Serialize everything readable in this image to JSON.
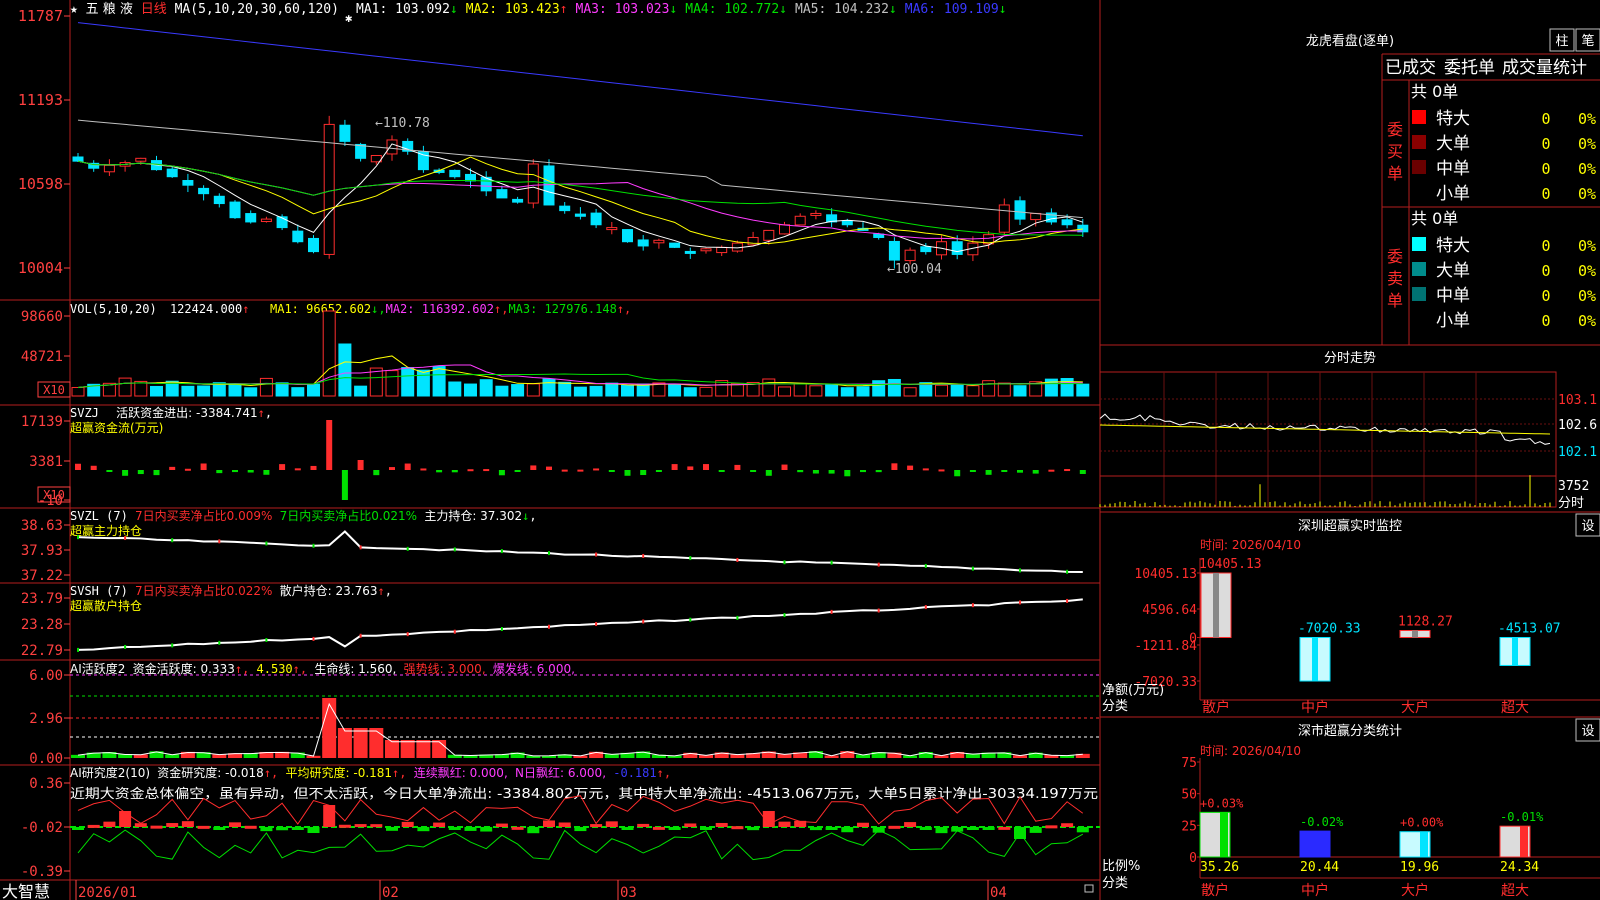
{
  "colors": {
    "bg": "#000000",
    "frame": "#b41e1e",
    "up": "#ff2d2d",
    "down": "#00e4ff",
    "green": "#00e000",
    "yellow": "#ffff00",
    "magenta": "#ff3cff",
    "white": "#ffffff",
    "blue": "#3a3aff",
    "gray": "#c0c0c0",
    "axis": "#ff4040"
  },
  "kline": {
    "header_star": "★",
    "title_name": "五 粮 液",
    "period": "日线",
    "ma_label": "MA(5,10,20,30,60,120)",
    "items": [
      {
        "text": "MA1: 103.092",
        "arrow": "↓",
        "color": "#ffffff"
      },
      {
        "text": "MA2: 103.423",
        "arrow": "↑",
        "color": "#ffff00"
      },
      {
        "text": "MA3: 103.023",
        "arrow": "↓",
        "color": "#ff3cff"
      },
      {
        "text": "MA4: 102.772",
        "arrow": "↓",
        "color": "#00e000"
      },
      {
        "text": "MA5: 104.232",
        "arrow": "↓",
        "color": "#c0c0c0"
      },
      {
        "text": "MA6: 109.109",
        "arrow": "↓",
        "color": "#3a3aff"
      }
    ],
    "yaxis": [
      "11787",
      "11193",
      "10598",
      "10004"
    ],
    "high_label": "←110.78",
    "low_label": "←100.04",
    "dates": [
      "2026/01",
      "02",
      "03",
      "04"
    ]
  },
  "vol": {
    "label": "VOL(5,10,20)",
    "value": "122424.000",
    "value_arrow": "↑",
    "items": [
      {
        "text": "MA1: 96652.602",
        "arrow": "↓",
        "color": "#ffff00"
      },
      {
        "text": "MA2: 116392.602",
        "arrow": "↑",
        "color": "#ff3cff"
      },
      {
        "text": "MA3: 127976.148",
        "arrow": "↑",
        "color": "#00e000"
      }
    ],
    "yaxis": [
      "98660",
      "48721"
    ],
    "unit": "X10"
  },
  "svzj": {
    "label": "SVZJ",
    "text": "活跃资金进出: -3384.741",
    "arrow": "↑",
    "sub": "超赢资金流(万元)",
    "yaxis": [
      "17139",
      "3381",
      "-10"
    ],
    "unit": "X10"
  },
  "svzl": {
    "label": "SVZL (7)",
    "red": "7日内买卖净占比0.009%",
    "green": "7日内买卖净占比0.021%",
    "text": "主力持仓: 37.302",
    "arrow": "↓",
    "sub": "超赢主力持仓",
    "yaxis": [
      "38.63",
      "37.93",
      "37.22"
    ]
  },
  "svsh": {
    "label": "SVSH (7)",
    "red": "7日内买卖净占比0.022%",
    "text": "散户持仓: 23.763",
    "arrow": "↑",
    "sub": "超赢散户持仓",
    "yaxis": [
      "23.79",
      "23.28",
      "22.79"
    ]
  },
  "ai1": {
    "label": "AI活跃度2",
    "t1": "资金活跃度: 0.333",
    "t2": "4.530",
    "t3": "生命线: 1.560,",
    "t4": "强势线: 3.000,",
    "t5": "爆发线: 6.000,",
    "yaxis": [
      "6.00",
      "2.96",
      "0.00"
    ]
  },
  "ai2": {
    "label": "AI研究度2(10)",
    "t1": "资金研究度: -0.018",
    "t2": "平均研究度: -0.181",
    "t3": "连续飘红: 0.000,",
    "t4": "N日飘红: 6.000,",
    "t5": "-0.181",
    "comment": "近期大资金总体偏空，虽有异动，但不太活跃，今日大单净流出: -3384.802万元，其中特大单净流出: -4513.067万元，大单5日累计净出-30334.197万元",
    "yaxis": [
      "0.36",
      "-0.02",
      "-0.39"
    ]
  },
  "brand": "大智慧",
  "lhb": {
    "title": "龙虎看盘(逐单)",
    "btn1": "柱",
    "btn2": "笔",
    "tabs": [
      "已成交",
      "委托单",
      "成交量统计"
    ],
    "buy": {
      "side": "委买单",
      "total": "共 0单",
      "rows": [
        {
          "name": "特大",
          "n": "0",
          "p": "0%",
          "color": "#ff0000"
        },
        {
          "name": "大单",
          "n": "0",
          "p": "0%",
          "color": "#8a0000"
        },
        {
          "name": "中单",
          "n": "0",
          "p": "0%",
          "color": "#6a0000"
        },
        {
          "name": "小单",
          "n": "0",
          "p": "0%",
          "color": ""
        }
      ]
    },
    "sell": {
      "side": "委卖单",
      "total": "共 0单",
      "rows": [
        {
          "name": "特大",
          "n": "0",
          "p": "0%",
          "color": "#00ffff"
        },
        {
          "name": "大单",
          "n": "0",
          "p": "0%",
          "color": "#008c8c"
        },
        {
          "name": "中单",
          "n": "0",
          "p": "0%",
          "color": "#007373"
        },
        {
          "name": "小单",
          "n": "0",
          "p": "0%",
          "color": ""
        }
      ]
    }
  },
  "fenshi": {
    "title": "分时走势",
    "yaxis": [
      "103.1",
      "102.6",
      "102.1"
    ],
    "vol": "3752",
    "unit": "分时"
  },
  "sz": {
    "title": "深圳超赢实时监控",
    "btn": "设",
    "time": "时间: 2026/04/10",
    "yaxis": [
      "10405.13",
      "4596.64",
      "0",
      "-1211.84",
      "-7020.33"
    ],
    "ylabel": "净额(万元)",
    "xlabel": "分类",
    "chart_data": {
      "type": "bar",
      "title": "深圳超赢实时监控",
      "categories": [
        "散户",
        "中户",
        "大户",
        "超大"
      ],
      "values": [
        10405.13,
        -7020.33,
        1128.27,
        -4513.07
      ],
      "ylabel": "净额(万元)",
      "xlabel": "分类",
      "ylim": [
        -7020.33,
        10405.13
      ]
    }
  },
  "ss": {
    "title": "深市超赢分类统计",
    "btn": "设",
    "time": "时间: 2026/04/10",
    "yaxis": [
      "75",
      "50",
      "25",
      "0"
    ],
    "ylabel": "比例%",
    "xlabel": "分类",
    "pct": [
      "+0.03%",
      "-0.02%",
      "+0.00%",
      "-0.01%"
    ],
    "chart_data": {
      "type": "bar",
      "title": "深市超赢分类统计",
      "categories": [
        "散户",
        "中户",
        "大户",
        "超大"
      ],
      "values": [
        35.26,
        20.44,
        19.96,
        24.34
      ],
      "ylabel": "比例%",
      "xlabel": "分类",
      "ylim": [
        0,
        75
      ]
    }
  }
}
